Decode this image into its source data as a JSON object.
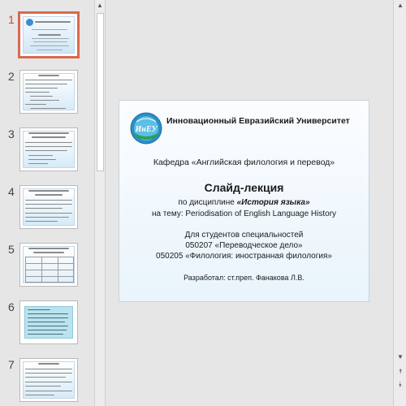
{
  "thumbnails": [
    {
      "number": "1"
    },
    {
      "number": "2"
    },
    {
      "number": "3"
    },
    {
      "number": "4"
    },
    {
      "number": "5"
    },
    {
      "number": "6"
    },
    {
      "number": "7"
    }
  ],
  "slide": {
    "university": "Инновационный Евразийский Университет",
    "logo_text": "ИнЕУ",
    "department": "Кафедра «Английская филология и перевод»",
    "title": "Слайд-лекция",
    "discipline_prefix": "по дисциплине ",
    "discipline_name": "«История языка»",
    "topic": "на тему: Periodisation of English Language History",
    "for_students": "Для студентов специальностей",
    "specialty1": "050207 «Переводческое дело»",
    "specialty2": "050205 «Филология: иностранная филология»",
    "author": "Разработал: ст.преп. Фанакова Л.В."
  },
  "colors": {
    "active_thumb_border": "#d9694f",
    "slide_bg": "#eef6fb"
  },
  "scrollbar": {
    "up_icon": "▲",
    "down_icon": "▼",
    "prev_slide_icon": "⯭",
    "next_slide_icon": "⯯"
  }
}
